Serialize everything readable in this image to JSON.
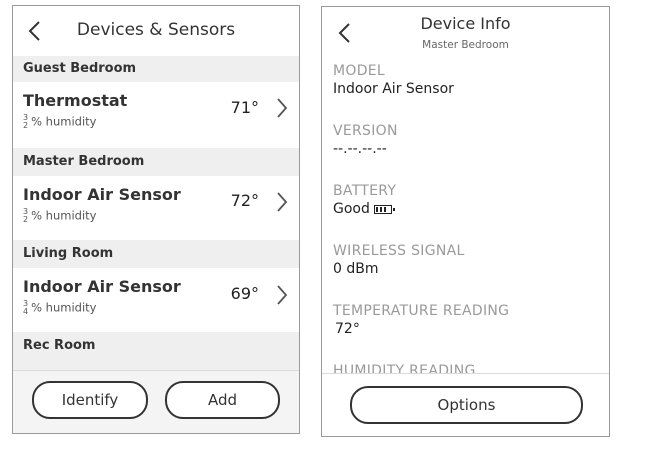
{
  "left_screen": {
    "title": "Devices & Sensors",
    "rooms": [
      {
        "name": "Guest Bedroom",
        "device": "Thermostat",
        "temp": "71°",
        "hum_top": "3",
        "hum_bottom": "2",
        "hum_label": "% humidity"
      },
      {
        "name": "Master Bedroom",
        "device": "Indoor Air Sensor",
        "temp": "72°",
        "hum_top": "3",
        "hum_bottom": "2",
        "hum_label": "% humidity"
      },
      {
        "name": "Living Room",
        "device": "Indoor Air Sensor",
        "temp": "69°",
        "hum_top": "3",
        "hum_bottom": "4",
        "hum_label": "% humidity"
      },
      {
        "name": "Rec Room"
      }
    ],
    "buttons": {
      "identify": "Identify",
      "add": "Add"
    }
  },
  "right_screen": {
    "title": "Device Info",
    "subtitle": "Master Bedroom",
    "fields": [
      {
        "label": "MODEL",
        "value": "Indoor Air Sensor"
      },
      {
        "label": "VERSION",
        "value": "--.--.--.--"
      },
      {
        "label": "BATTERY",
        "value": "Good"
      },
      {
        "label": "WIRELESS SIGNAL",
        "value": "0 dBm"
      },
      {
        "label": "TEMPERATURE READING",
        "value": "72°"
      },
      {
        "label": "HUMIDITY READING",
        "value": ""
      }
    ],
    "battery_icon": "battery-full-icon",
    "options_button": "Options"
  }
}
